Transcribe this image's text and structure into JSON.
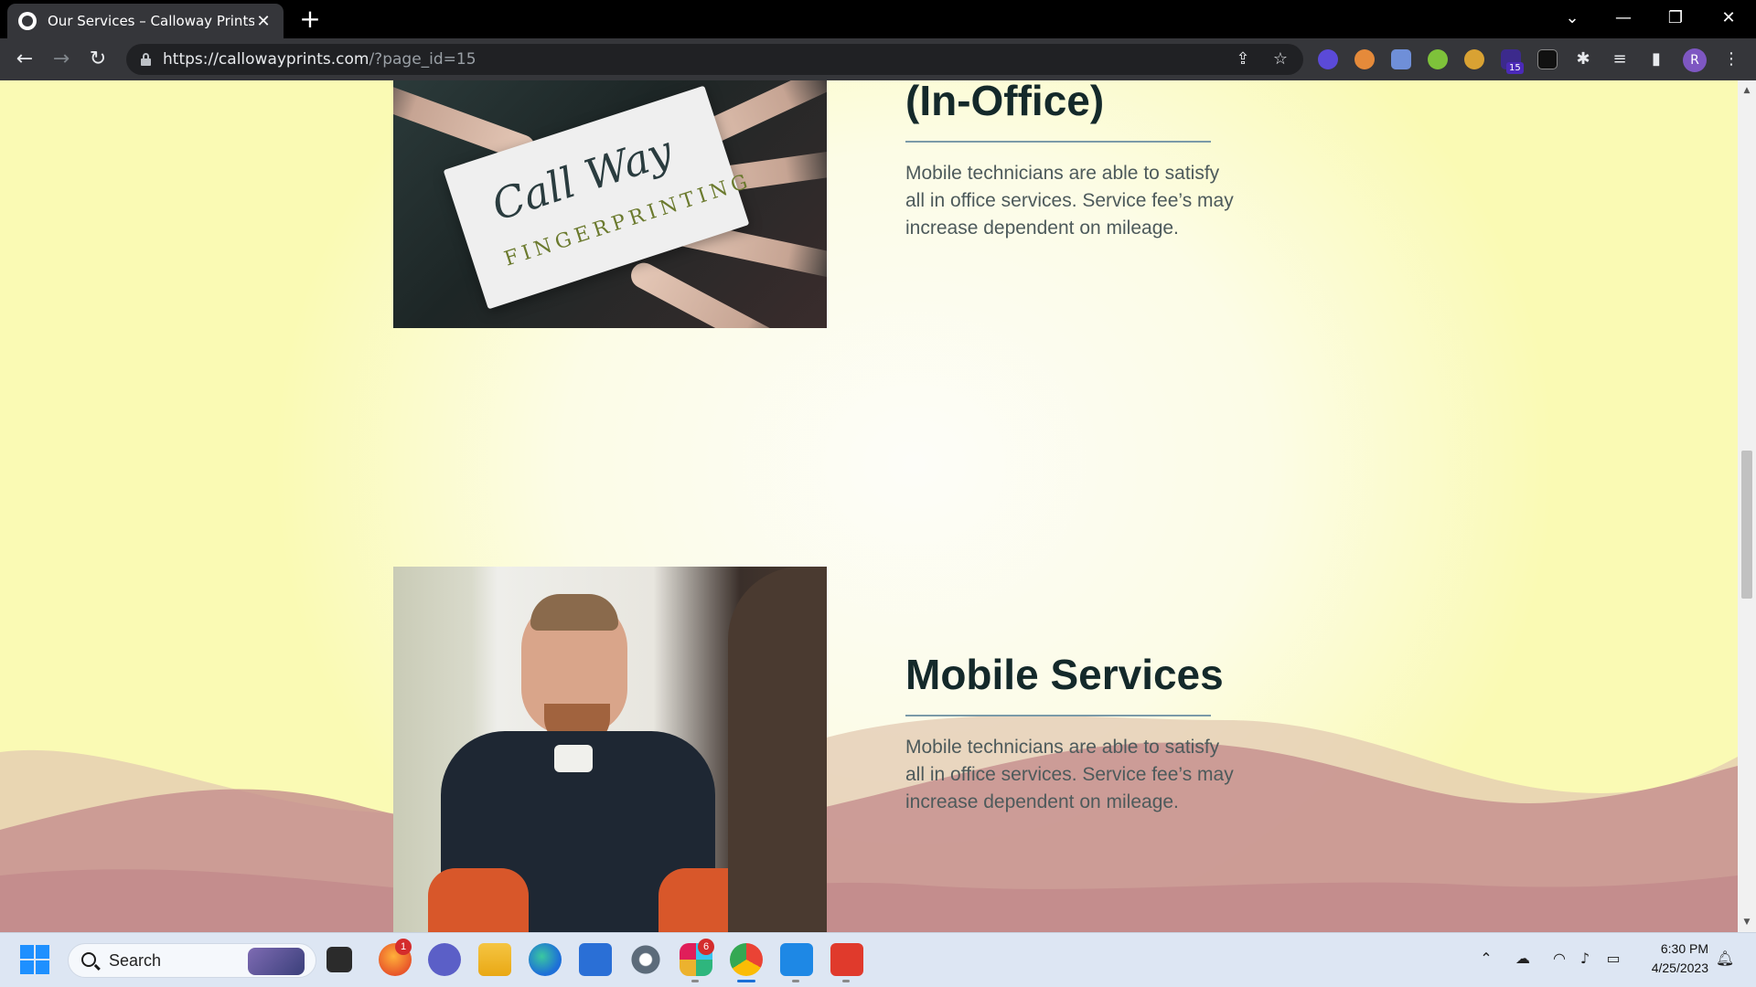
{
  "browser": {
    "tab_title": "Our Services – Calloway Prints",
    "tab_close": "✕",
    "new_tab": "+",
    "url_host": "https://callowayprints.com",
    "url_path": "/?page_id=15",
    "profile_initial": "R",
    "extension_badge": "15",
    "window_controls": {
      "menu": "⌄",
      "minimize": "—",
      "restore": "❐",
      "close": "✕"
    }
  },
  "page": {
    "section1": {
      "title": "(In-Office)",
      "description": "Mobile technicians are able to satisfy all in office services. Service fee’s may increase dependent on mileage.",
      "image_logo": "Call Way",
      "image_logo_sub": "FINGERPRINTING"
    },
    "section2": {
      "title": "Mobile Services",
      "description": "Mobile technicians are able to satisfy all in office services. Service fee’s may increase dependent on mileage."
    },
    "colors": {
      "heading": "#14292a",
      "divider": "#7b9aa8",
      "wave_dark": "#c48d8d",
      "wave_light": "#e3c9b2"
    }
  },
  "taskbar": {
    "search_label": "Search",
    "firefox_badge": "1",
    "slack_badge": "6",
    "clock_time": "6:30 PM",
    "clock_date": "4/25/2023"
  }
}
